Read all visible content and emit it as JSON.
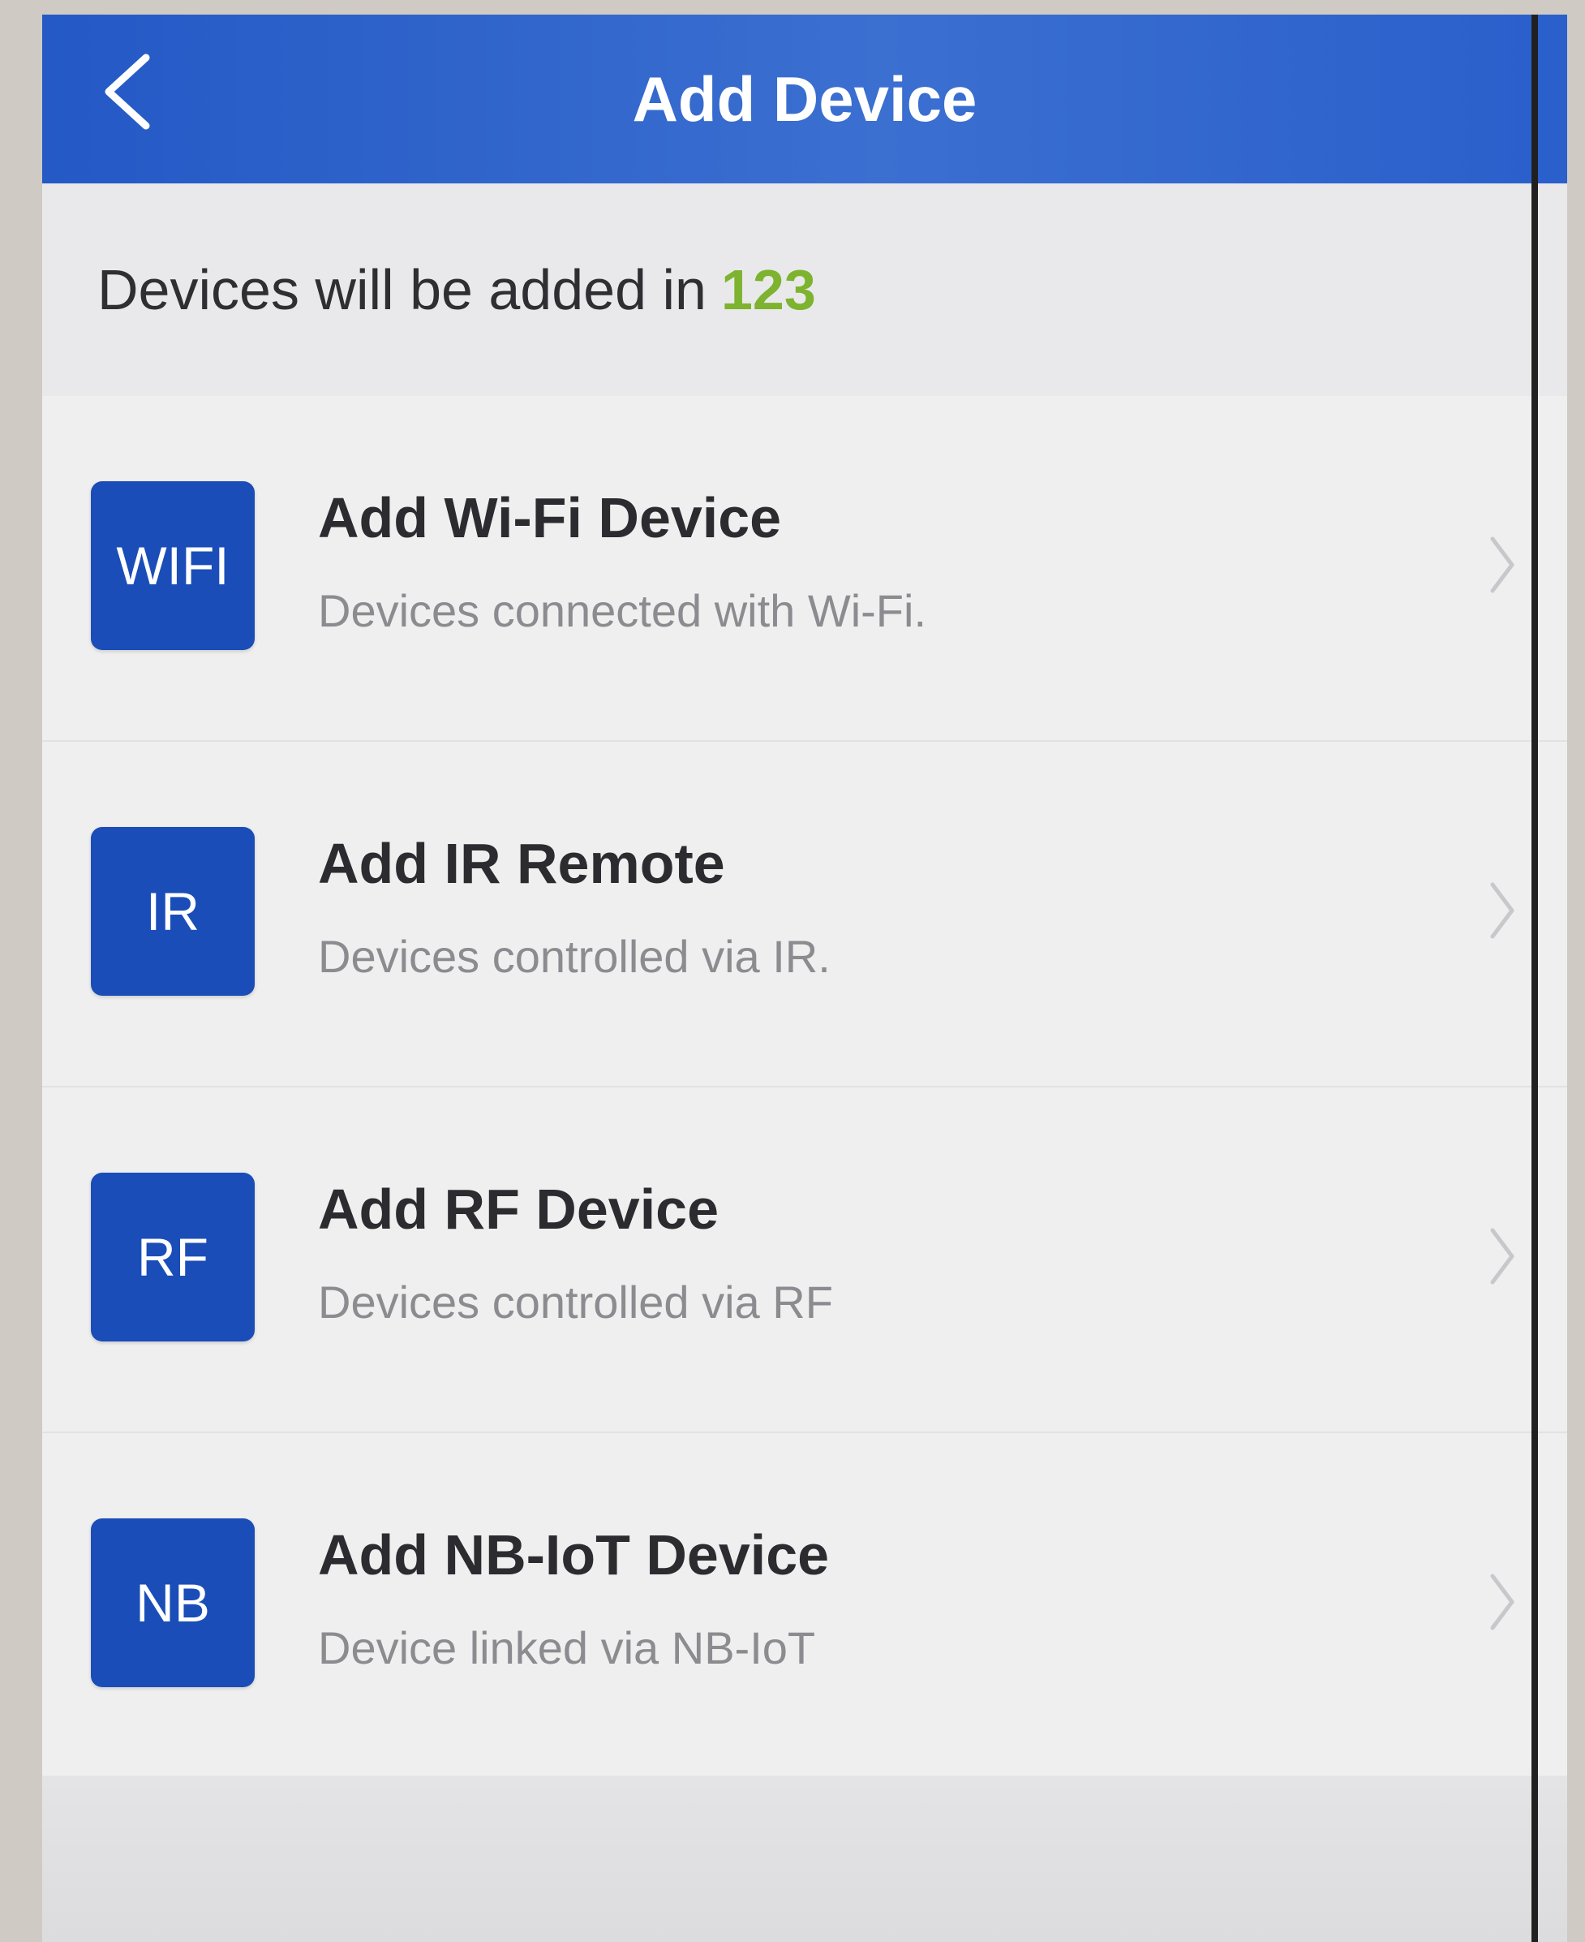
{
  "header": {
    "title": "Add Device",
    "back_icon": "chevron-left-icon"
  },
  "subheader": {
    "prefix": "Devices will be added in",
    "group_name": "123",
    "group_color": "#7db32f"
  },
  "colors": {
    "header_bg": "#2459c6",
    "badge_bg": "#1a4db8"
  },
  "items": [
    {
      "badge": "WIFI",
      "title": "Add Wi-Fi Device",
      "description": "Devices connected with Wi-Fi."
    },
    {
      "badge": "IR",
      "title": "Add IR Remote",
      "description": "Devices controlled via IR."
    },
    {
      "badge": "RF",
      "title": "Add RF Device",
      "description": "Devices controlled via RF"
    },
    {
      "badge": "NB",
      "title": "Add NB-IoT Device",
      "description": "Device linked via NB-IoT"
    }
  ]
}
